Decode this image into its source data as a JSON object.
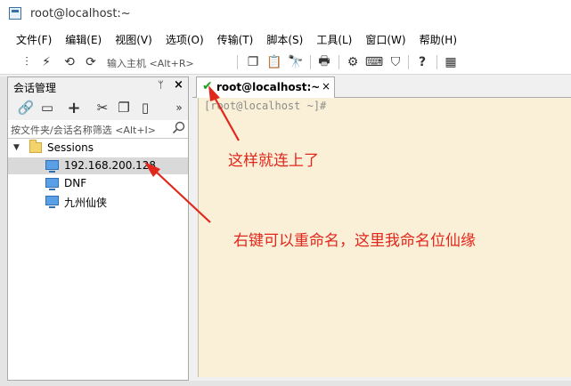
{
  "window": {
    "title": "root@localhost:~"
  },
  "menu": [
    "文件(F)",
    "编辑(E)",
    "视图(V)",
    "选项(O)",
    "传输(T)",
    "脚本(S)",
    "工具(L)",
    "窗口(W)",
    "帮助(H)"
  ],
  "toolbar": {
    "host_input_placeholder": "输入主机 <Alt+R>"
  },
  "session_panel": {
    "title": "会话管理",
    "pin": "📌",
    "close": "×",
    "more": "»",
    "filter_placeholder": "按文件夹/会话名称筛选 <Alt+I>",
    "tree": {
      "folder": "Sessions",
      "items": [
        "192.168.200.128",
        "DNF",
        "九州仙侠"
      ]
    }
  },
  "tab": {
    "label": "root@localhost:~",
    "close": "×"
  },
  "terminal": {
    "prompt": "[root@localhost ~]#"
  },
  "annotations": {
    "connected": "这样就连上了",
    "rename": "右键可以重命名，这里我命名位仙缘"
  },
  "colors": {
    "annotation": "#e1261c",
    "terminal_bg": "#faf0d7",
    "selected_row": "#d9d9d9",
    "connected_check": "#1aa31a"
  }
}
